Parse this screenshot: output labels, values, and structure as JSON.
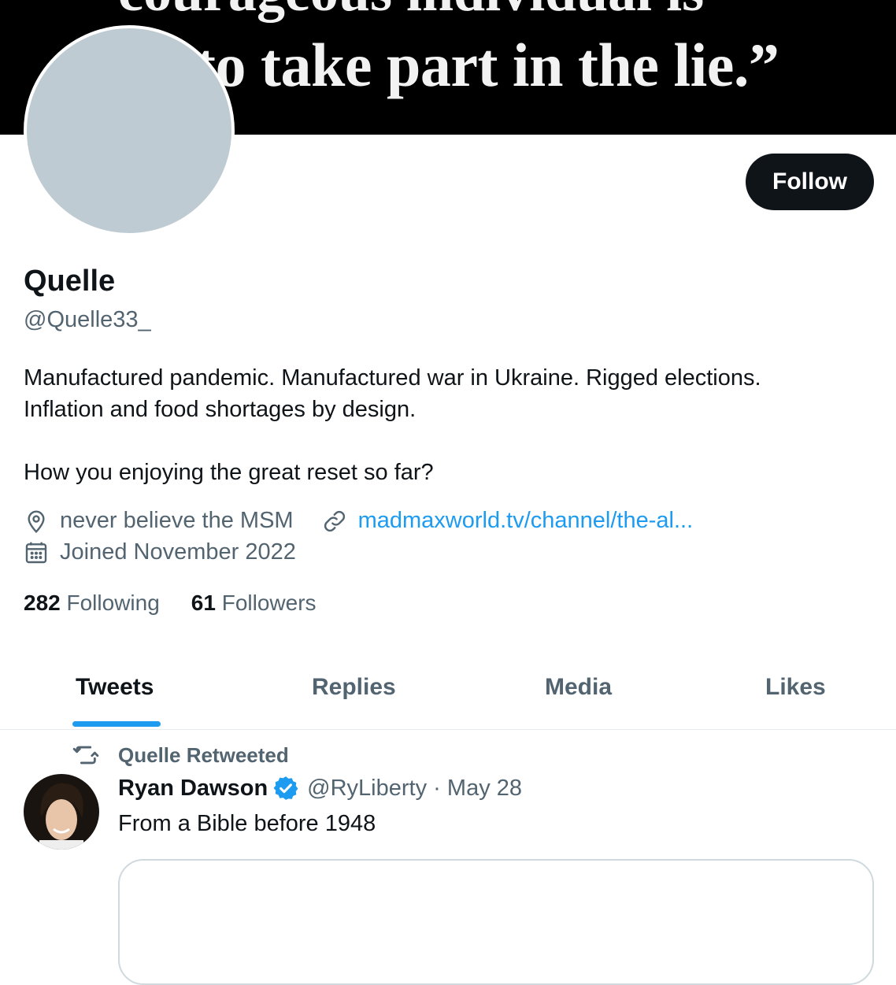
{
  "banner": {
    "line1": "courageous individual is",
    "line2": "to take part in the lie.”"
  },
  "follow_label": "Follow",
  "profile": {
    "name": "Quelle",
    "handle": "@Quelle33_",
    "bio_line1": "Manufactured pandemic. Manufactured war in Ukraine. Rigged elections.",
    "bio_line2": "Inflation and food shortages by design.",
    "bio_line3": "How you enjoying the great reset so far?",
    "location": "never believe the MSM",
    "link": "madmaxworld.tv/channel/the-al...",
    "joined": "Joined November 2022",
    "following_count": "282",
    "following_label": "Following",
    "followers_count": "61",
    "followers_label": "Followers"
  },
  "tabs": [
    "Tweets",
    "Replies",
    "Media",
    "Likes"
  ],
  "retweet_label": "Quelle Retweeted",
  "tweet": {
    "author": "Ryan Dawson",
    "handle": "@RyLiberty",
    "separator": "·",
    "date": "May 28",
    "text": "From a Bible before 1948"
  },
  "icons": {
    "location": "location-pin-icon",
    "link": "link-icon",
    "calendar": "calendar-icon",
    "retweet": "retweet-icon",
    "verified": "verified-badge-icon"
  },
  "colors": {
    "accent": "#1d9bf0",
    "text": "#0f1419",
    "secondary": "#536471",
    "avatar_placeholder": "#bfcbd2"
  }
}
